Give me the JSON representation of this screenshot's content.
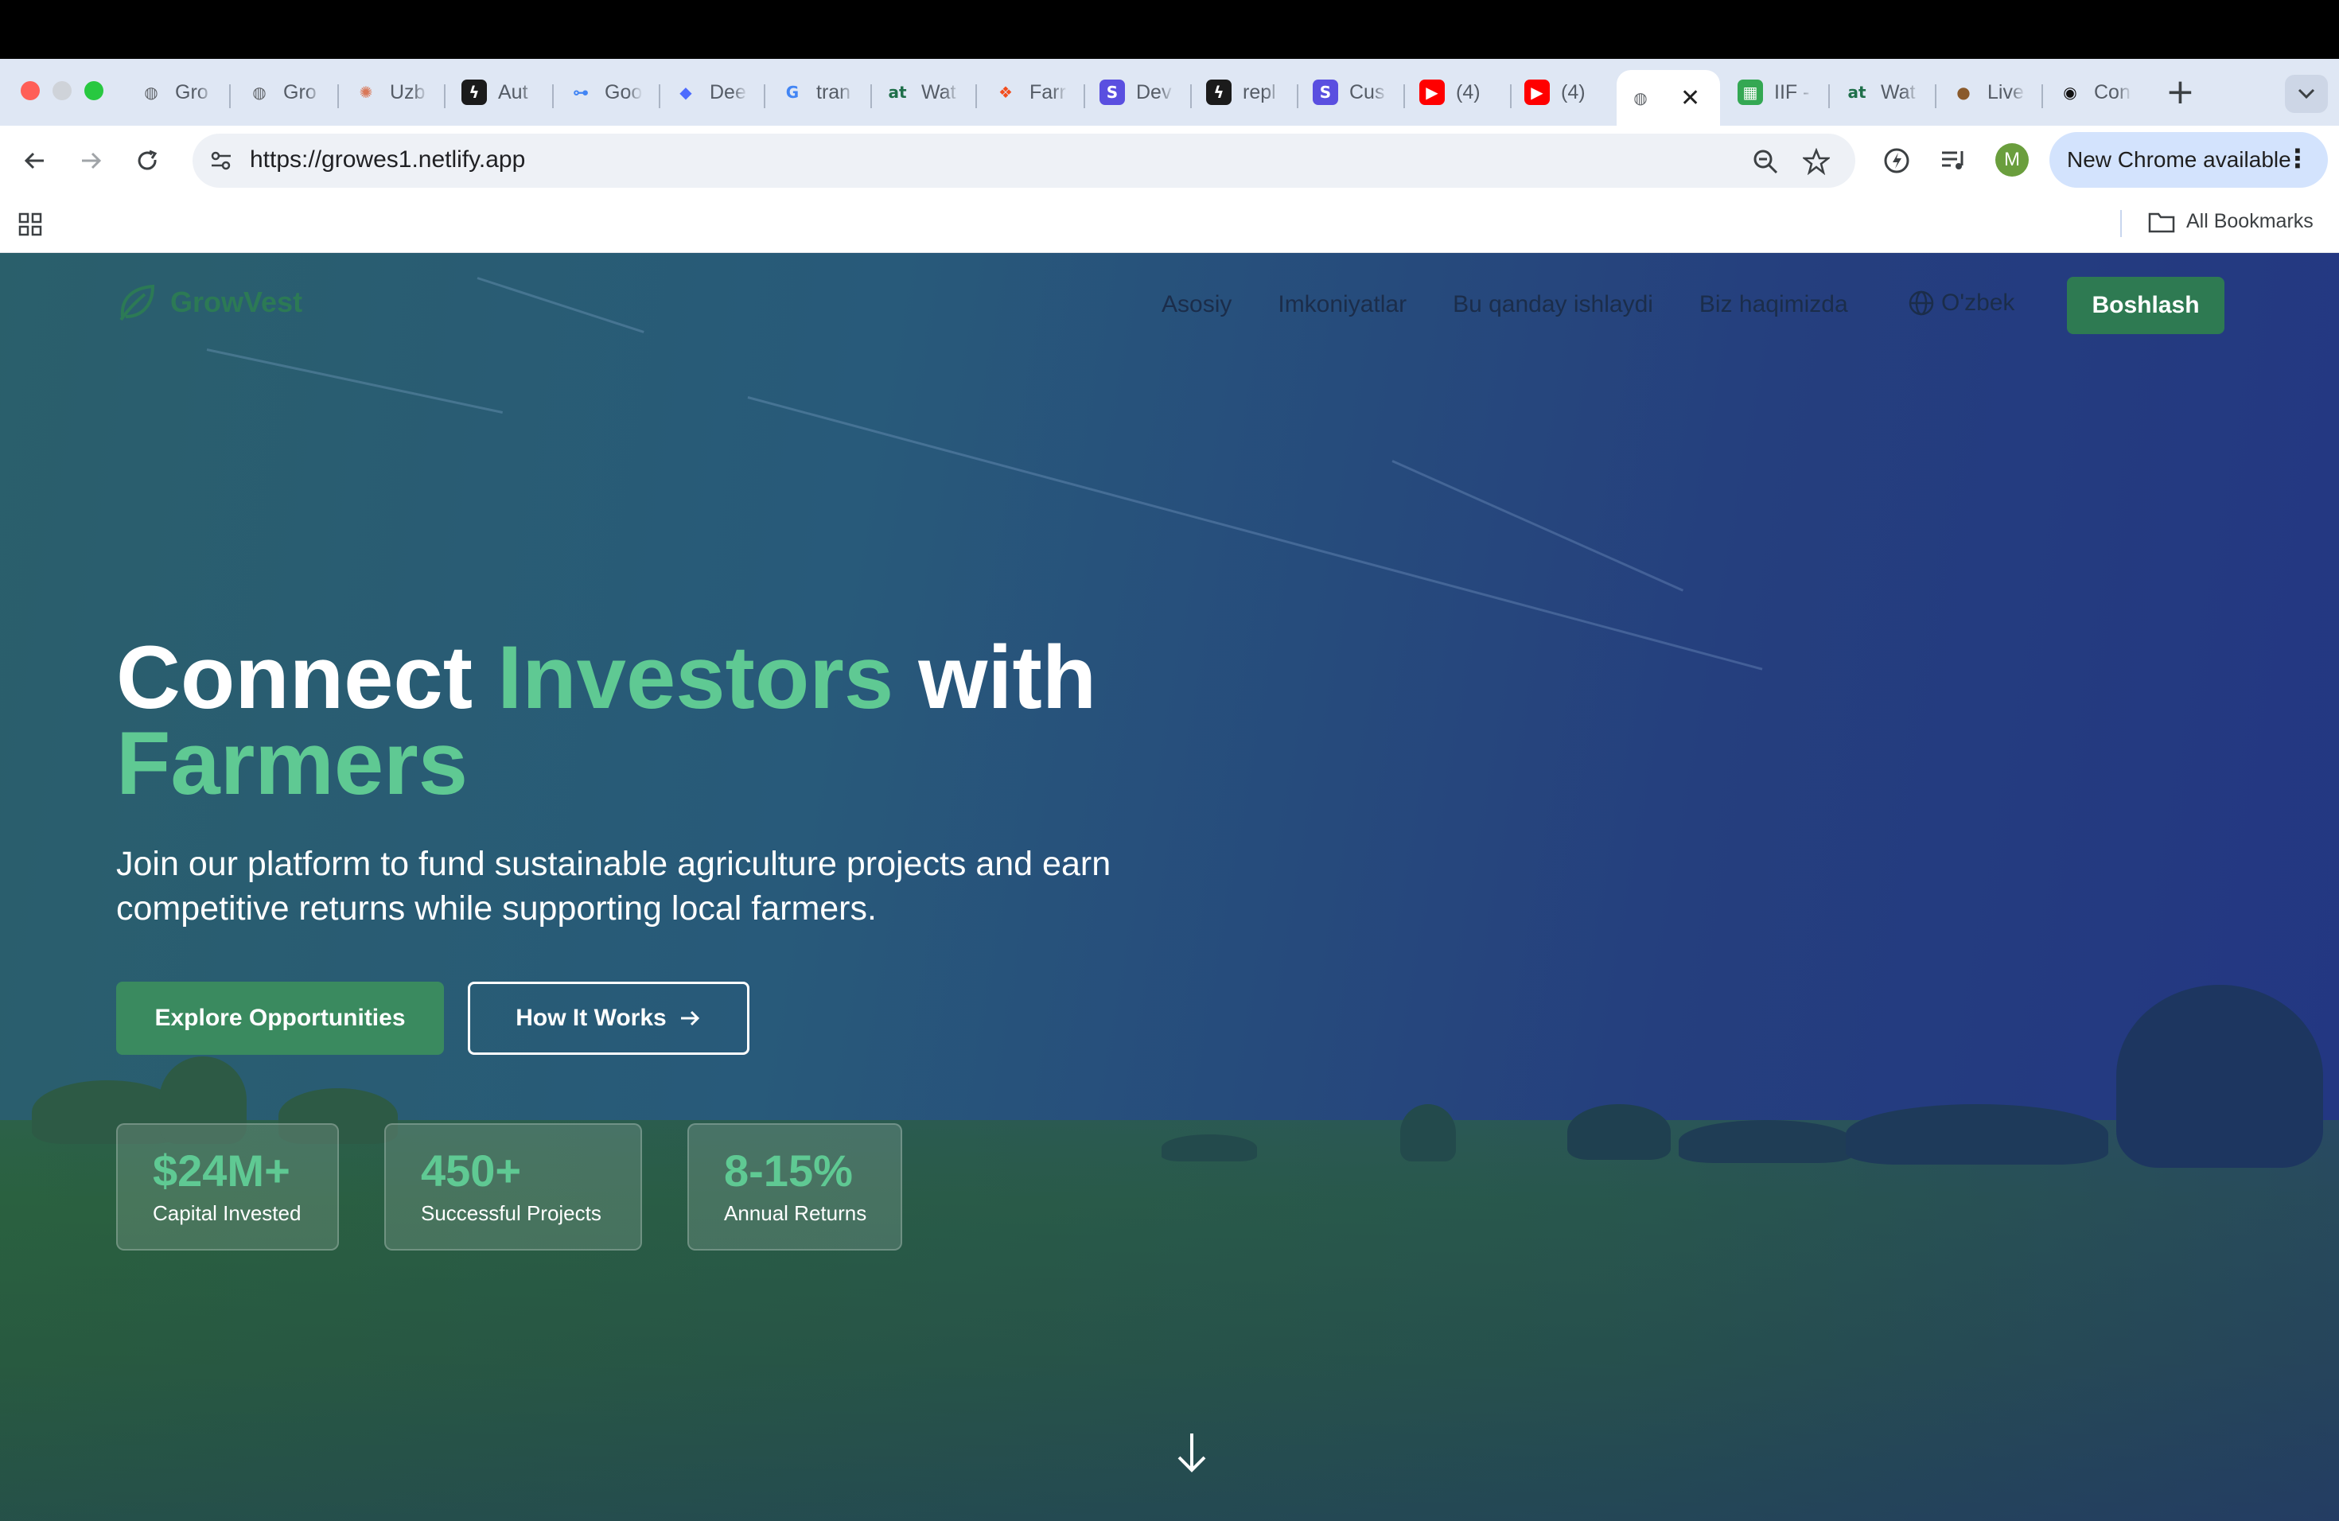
{
  "browser": {
    "tabs": [
      {
        "icon": "globe-icon",
        "title": "Gro",
        "icon_color": "#5f6368"
      },
      {
        "icon": "globe-icon",
        "title": "Gro",
        "icon_color": "#5f6368"
      },
      {
        "icon": "claude-icon",
        "title": "Uzb",
        "icon_color": "#d97757"
      },
      {
        "icon": "bolt-icon",
        "title": "Aut",
        "icon_color": "#1b1b1b"
      },
      {
        "icon": "google-key-icon",
        "title": "Goo",
        "icon_color": "#4285f4"
      },
      {
        "icon": "deepseek-icon",
        "title": "Dee",
        "icon_color": "#4d6bfe"
      },
      {
        "icon": "google-icon",
        "title": "tran",
        "icon_color": "#4285f4"
      },
      {
        "icon": "at-icon",
        "title": "Wat",
        "icon_color": "#1f6f4a"
      },
      {
        "icon": "figma-icon",
        "title": "Farr",
        "icon_color": "#f24e1e"
      },
      {
        "icon": "s-icon",
        "title": "Dev",
        "icon_color": "#5a4fe0"
      },
      {
        "icon": "bolt-icon",
        "title": "repl",
        "icon_color": "#1b1b1b"
      },
      {
        "icon": "s-icon",
        "title": "Cus",
        "icon_color": "#5a4fe0"
      },
      {
        "icon": "youtube-icon",
        "title": "(4)",
        "icon_color": "#ff0000"
      },
      {
        "icon": "youtube-icon",
        "title": "(4)",
        "icon_color": "#ff0000"
      },
      {
        "icon": "globe-icon",
        "title": "",
        "icon_color": "#5f6368",
        "active": true
      },
      {
        "icon": "sheets-icon",
        "title": "IIF -",
        "icon_color": "#34a853"
      },
      {
        "icon": "at-icon",
        "title": "Wat",
        "icon_color": "#1f6f4a"
      },
      {
        "icon": "live-icon",
        "title": "Live",
        "icon_color": "#8a5a2b"
      },
      {
        "icon": "github-icon",
        "title": "Con",
        "icon_color": "#111111"
      }
    ],
    "url": "https://growes1.netlify.app",
    "update_label": "New Chrome available",
    "profile_initial": "M",
    "bookmarks_label": "All Bookmarks"
  },
  "site": {
    "logo_text": "GrowVest",
    "nav": [
      "Asosiy",
      "Imkoniyatlar",
      "Bu qanday ishlaydi",
      "Biz haqimizda"
    ],
    "language": "O'zbek",
    "cta": "Boshlash"
  },
  "hero": {
    "headline_1": "Connect ",
    "headline_2": "Investors",
    "headline_3": " with",
    "headline_4": "Farmers",
    "subtext": "Join our platform to fund sustainable agriculture projects and earn competitive returns while supporting local farmers.",
    "primary_button": "Explore Opportunities",
    "secondary_button": "How It Works",
    "stats": [
      {
        "value": "$24M+",
        "label": "Capital Invested"
      },
      {
        "value": "450+",
        "label": "Successful Projects"
      },
      {
        "value": "8-15%",
        "label": "Annual Returns"
      }
    ]
  },
  "colors": {
    "brand_green": "#2e7a52",
    "accent_green": "#5fc993",
    "hero_blue": "#253f7e"
  }
}
